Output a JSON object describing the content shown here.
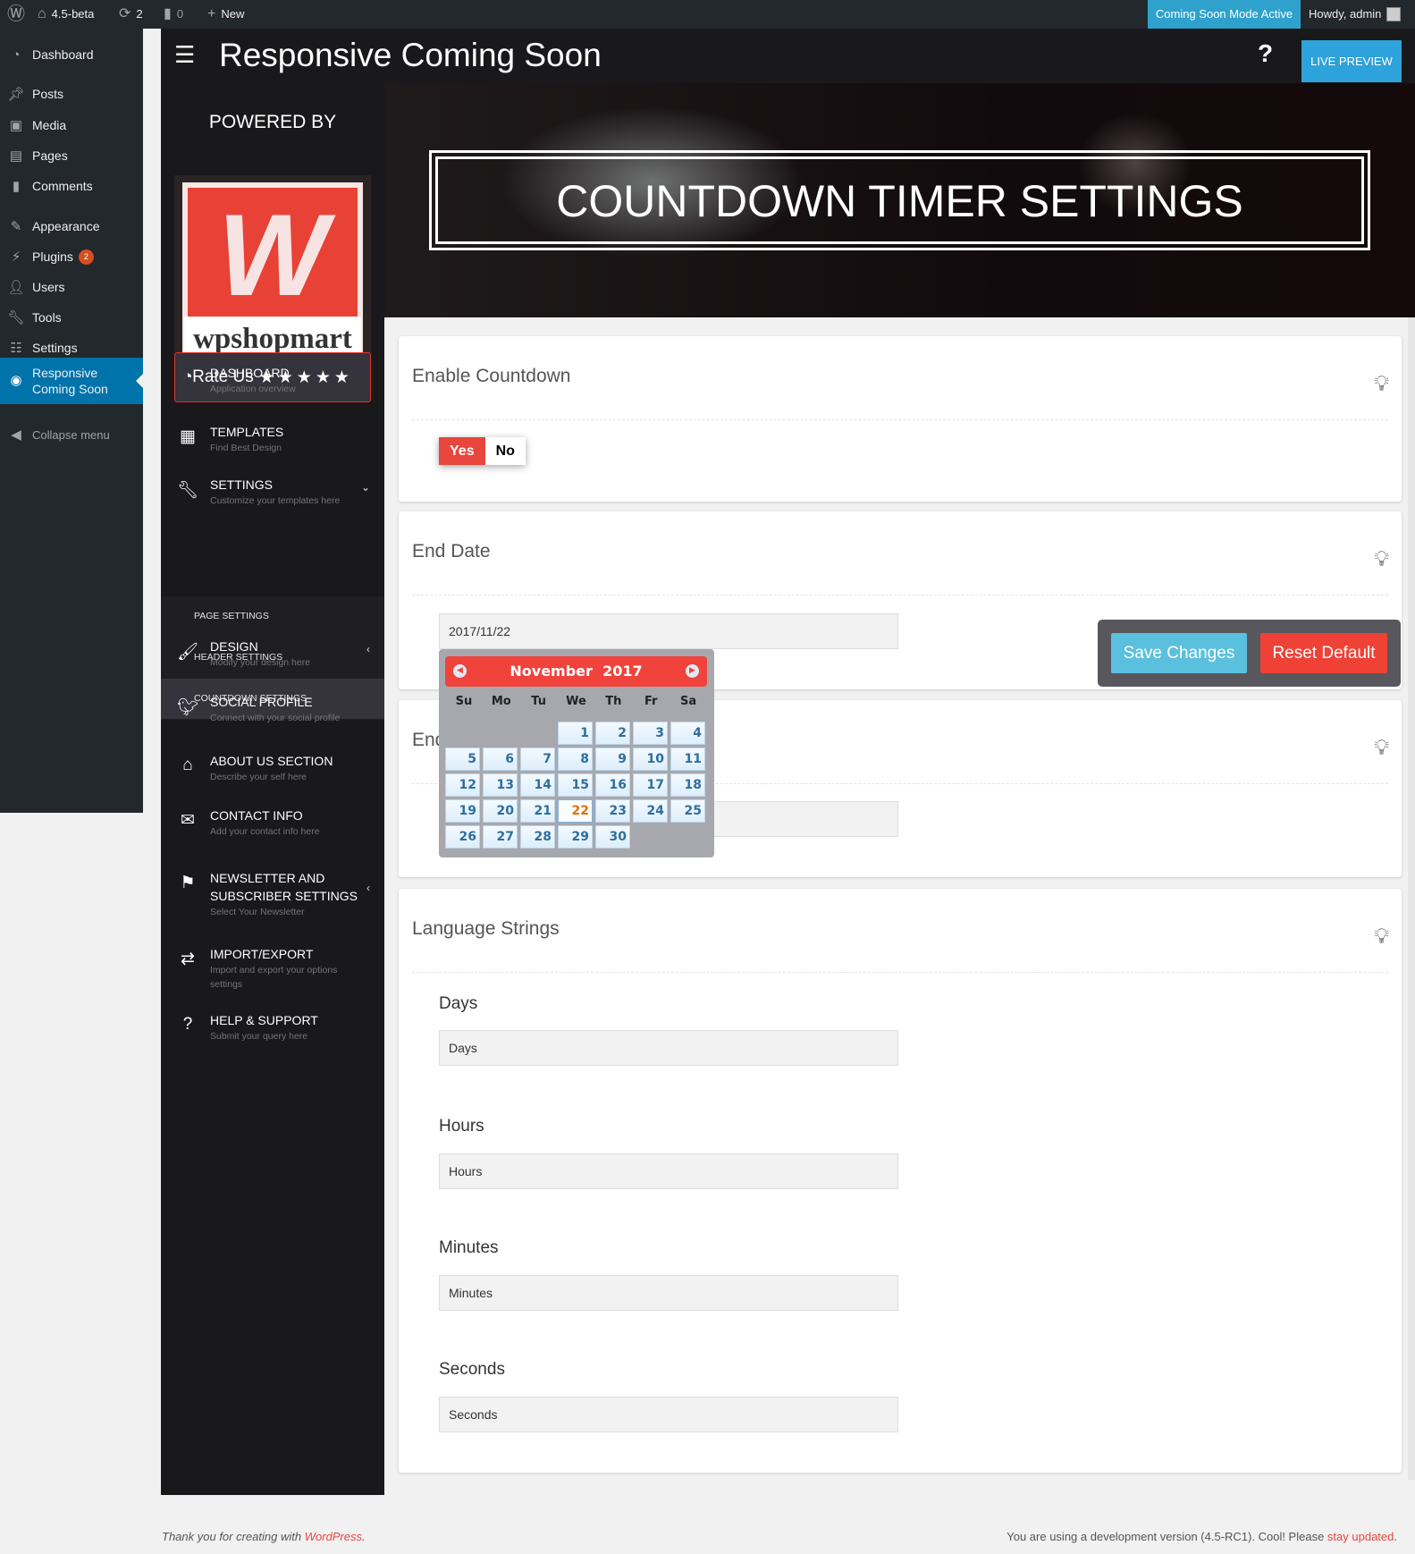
{
  "adminbar": {
    "site": "4.5-beta",
    "updates": "2",
    "comments": "0",
    "new": "New",
    "coming_soon": "Coming Soon Mode Active",
    "howdy": "Howdy, admin"
  },
  "wp_menu": [
    {
      "label": "Dashboard",
      "icon": "dashboard-icon"
    },
    {
      "label": "Posts",
      "icon": "pin-icon"
    },
    {
      "label": "Media",
      "icon": "media-icon"
    },
    {
      "label": "Pages",
      "icon": "pages-icon"
    },
    {
      "label": "Comments",
      "icon": "comment-icon"
    },
    {
      "label": "Appearance",
      "icon": "brush-icon"
    },
    {
      "label": "Plugins",
      "icon": "plugin-icon",
      "badge": "2"
    },
    {
      "label": "Users",
      "icon": "user-icon"
    },
    {
      "label": "Tools",
      "icon": "wrench-icon"
    },
    {
      "label": "Settings",
      "icon": "settings-icon"
    },
    {
      "label": "Responsive Coming Soon",
      "icon": "eye-icon",
      "active": true
    },
    {
      "label": "Collapse menu",
      "icon": "collapse-icon"
    }
  ],
  "header": {
    "title": "Responsive Coming Soon",
    "help": "?",
    "live_preview": "LIVE PREVIEW"
  },
  "plugin_sidebar": {
    "powered_by": "POWERED BY",
    "logo_text": "wpshopmart",
    "rate_us": "Rate Us",
    "stars": 5,
    "items": [
      {
        "title": "DASHBOARD",
        "sub": "Application overview"
      },
      {
        "title": "TEMPLATES",
        "sub": "Find Best Design"
      },
      {
        "title": "SETTINGS",
        "sub": "Customize your templates here"
      },
      {
        "title": "DESIGN",
        "sub": "Modify your design here"
      },
      {
        "title": "SOCIAL PROFILE",
        "sub": "Connect with your social profile"
      },
      {
        "title": "ABOUT US SECTION",
        "sub": "Describe your self here"
      },
      {
        "title": "CONTACT INFO",
        "sub": "Add your contact info here"
      },
      {
        "title": "NEWSLETTER AND SUBSCRIBER SETTINGS",
        "sub": "Select Your Newsletter"
      },
      {
        "title": "IMPORT/EXPORT",
        "sub": "Import and export your options settings"
      },
      {
        "title": "HELP & SUPPORT",
        "sub": "Submit your query here"
      }
    ],
    "submenu": [
      "PAGE SETTINGS",
      "HEADER SETTINGS",
      "COUNTDOWN SETTINGS"
    ]
  },
  "banner": {
    "title": "COUNTDOWN TIMER SETTINGS"
  },
  "enable_countdown": {
    "title": "Enable Countdown",
    "yes": "Yes",
    "no": "No",
    "value": "Yes"
  },
  "end_date": {
    "title": "End Date",
    "value": "2017/11/22"
  },
  "end_third": {
    "title": "End"
  },
  "calendar": {
    "month": "November",
    "year": "2017",
    "day_names": [
      "Su",
      "Mo",
      "Tu",
      "We",
      "Th",
      "Fr",
      "Sa"
    ],
    "first_weekday": 3,
    "days": 30,
    "selected": 22
  },
  "language": {
    "title": "Language Strings",
    "fields": [
      {
        "label": "Days",
        "value": "Days"
      },
      {
        "label": "Hours",
        "value": "Hours"
      },
      {
        "label": "Minutes",
        "value": "Minutes"
      },
      {
        "label": "Seconds",
        "value": "Seconds"
      }
    ]
  },
  "actions": {
    "save": "Save Changes",
    "reset": "Reset Default"
  },
  "footer": {
    "left_prefix": "Thank you for creating with ",
    "left_link": "WordPress",
    "left_suffix": ".",
    "right_prefix": "You are using a development version (4.5-RC1). Cool! Please ",
    "right_link": "stay updated",
    "right_suffix": "."
  },
  "colors": {
    "accent_blue": "#2ea2cc",
    "accent_red": "#e8453c",
    "wp_admin": "#23282d",
    "wp_active": "#0073aa"
  }
}
